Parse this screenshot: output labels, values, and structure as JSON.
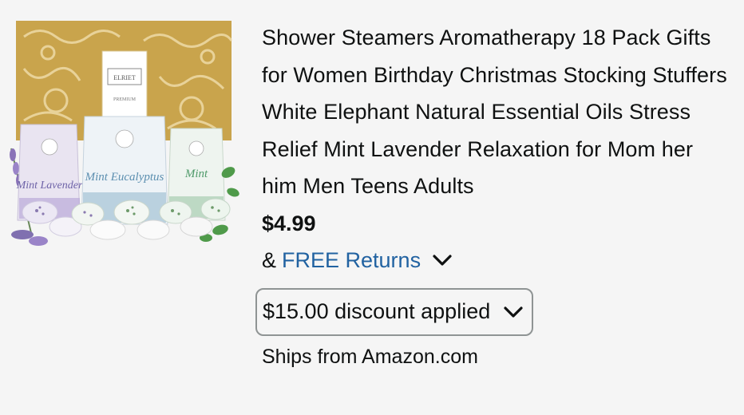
{
  "product": {
    "image_alt": "product-box-with-bath-bombs",
    "title": "Shower Steamers Aromatherapy 18 Pack Gifts for Women Birthday Christmas Stocking Stuffers White Elephant Natural Essential Oils Stress Relief Mint Lavender Relaxation for Mom her him Men Teens Adults",
    "price": "$4.99",
    "returns_prefix": "&",
    "returns_link": "FREE Returns",
    "discount_label": "$15.00 discount applied",
    "ships_from": "Ships from Amazon.com",
    "image_text": {
      "brand": "ELRIET",
      "box_label": "PREMIUM",
      "pouch_left": "Mint Lavender",
      "pouch_center": "Mint Eucalyptus",
      "pouch_right": "Mint"
    }
  },
  "colors": {
    "link": "#2162a1",
    "background": "#f5f5f5",
    "border": "#8f9494",
    "gold": "#c9a44c"
  },
  "icons": {
    "returns_chevron": "chevron-down-icon",
    "discount_chevron": "chevron-down-icon"
  }
}
